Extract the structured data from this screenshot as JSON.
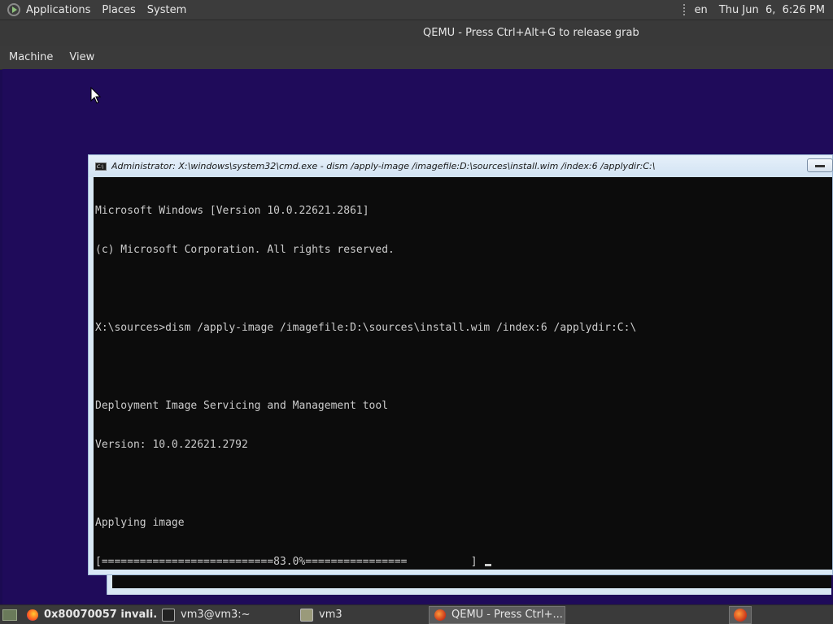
{
  "top_panel": {
    "menus": [
      "Applications",
      "Places",
      "System"
    ],
    "language": "en",
    "clock": "Thu Jun  6,  6:26 PM"
  },
  "qemu": {
    "title": "QEMU - Press Ctrl+Alt+G to release grab",
    "menus": [
      "Machine",
      "View"
    ]
  },
  "cmd": {
    "title": "Administrator: X:\\windows\\system32\\cmd.exe - dism  /apply-image /imagefile:D:\\sources\\install.wim /index:6 /applydir:C:\\",
    "icon_text": "C:\\",
    "lines": [
      "Microsoft Windows [Version 10.0.22621.2861]",
      "(c) Microsoft Corporation. All rights reserved.",
      "",
      "X:\\sources>dism /apply-image /imagefile:D:\\sources\\install.wim /index:6 /applydir:C:\\",
      "",
      "Deployment Image Servicing and Management tool",
      "Version: 10.0.22621.2792",
      "",
      "Applying image",
      "[===========================83.0%================          ]"
    ],
    "progress_percent": 83.0
  },
  "taskbar": {
    "tasks": [
      {
        "label": "0x80070057 invali...",
        "icon": "firefox-icon"
      },
      {
        "label": "vm3@vm3:~",
        "icon": "terminal-icon"
      },
      {
        "label": "vm3",
        "icon": "folder-icon"
      },
      {
        "label": "QEMU - Press Ctrl+...",
        "icon": "qemu-icon"
      }
    ]
  }
}
